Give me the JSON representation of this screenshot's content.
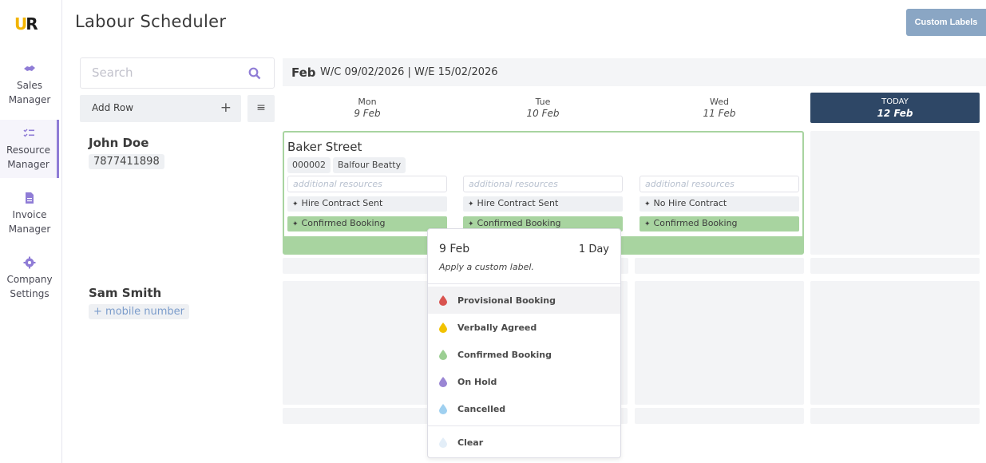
{
  "app": {
    "title": "Labour Scheduler",
    "custom_labels_button": "Custom Labels"
  },
  "sidebar": {
    "items": [
      {
        "label_line1": "Sales",
        "label_line2": "Manager",
        "icon": "handshake-icon"
      },
      {
        "label_line1": "Resource",
        "label_line2": "Manager",
        "icon": "list-check-icon",
        "active": true
      },
      {
        "label_line1": "Invoice",
        "label_line2": "Manager",
        "icon": "invoice-icon"
      },
      {
        "label_line1": "Company",
        "label_line2": "Settings",
        "icon": "gear-icon"
      }
    ]
  },
  "search": {
    "placeholder": "Search"
  },
  "toolbar": {
    "add_row_label": "Add Row",
    "add_symbol": "+",
    "menu_symbol": "≡"
  },
  "week": {
    "month": "Feb",
    "range": "W/C 09/02/2026  |  W/E 15/02/2026"
  },
  "days": [
    {
      "name": "Mon",
      "date": "9 Feb"
    },
    {
      "name": "Tue",
      "date": "10 Feb"
    },
    {
      "name": "Wed",
      "date": "11 Feb"
    },
    {
      "name": "TODAY",
      "date": "12 Feb",
      "today": true
    }
  ],
  "people": [
    {
      "name": "John Doe",
      "phone": "7877411898"
    },
    {
      "name": "Sam Smith",
      "phone": "+ mobile number"
    }
  ],
  "booking": {
    "title": "Baker Street",
    "tags": [
      "000002",
      "Balfour Beatty"
    ],
    "additional_placeholder": "additional resources",
    "contract_status": [
      "Hire Contract Sent",
      "Hire Contract Sent",
      "No Hire Contract"
    ],
    "booking_status": [
      "Confirmed Booking",
      "Confirmed Booking",
      "Confirmed Booking"
    ],
    "pin_symbol": "✦"
  },
  "popup": {
    "date": "9 Feb",
    "duration": "1 Day",
    "subtitle": "Apply a custom label.",
    "options": [
      {
        "label": "Provisional Booking",
        "color": "#d9534f"
      },
      {
        "label": "Verbally Agreed",
        "color": "#f2c200"
      },
      {
        "label": "Confirmed Booking",
        "color": "#9ccf93"
      },
      {
        "label": "On Hold",
        "color": "#9a86d4"
      },
      {
        "label": "Cancelled",
        "color": "#9fd0f0"
      }
    ],
    "clear": {
      "label": "Clear",
      "color": "#e3eef8"
    }
  },
  "colors": {
    "accent": "#8f7cd6",
    "today_bg": "#2e4766",
    "confirmed_green": "#a8d4a0",
    "button_blue": "#8aa6c4"
  }
}
